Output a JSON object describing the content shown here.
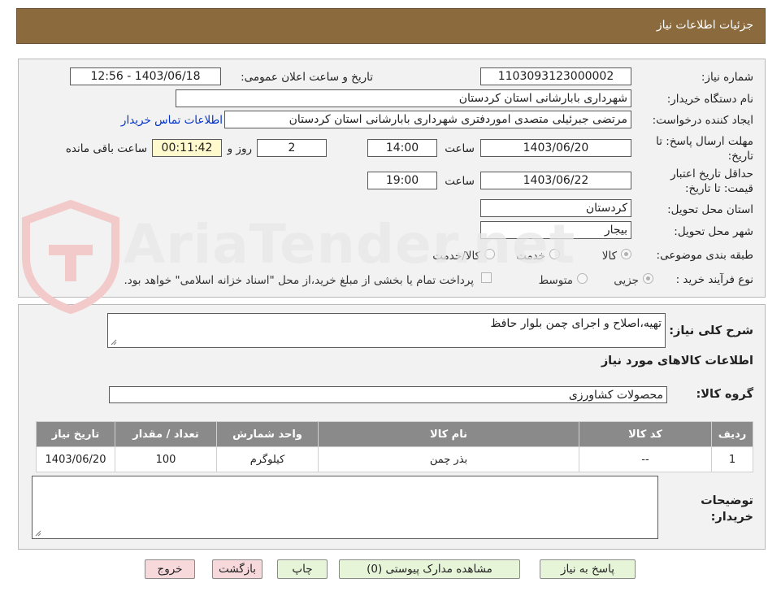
{
  "header": {
    "title": "جزئیات اطلاعات نیاز"
  },
  "need": {
    "number_label": "شماره نیاز:",
    "number": "1103093123000002",
    "announce_label": "تاریخ و ساعت اعلان عمومی:",
    "announce_value": "1403/06/18 - 12:56",
    "buyer_label": "نام دستگاه خریدار:",
    "buyer": "شهرداری بابارشانی استان کردستان",
    "creator_label": "ایجاد کننده درخواست:",
    "creator": "مرتضی جبرئیلی متصدی اموردفتری شهرداری بابارشانی استان کردستان",
    "contact_link": "اطلاعات تماس خریدار",
    "deadline_label": "مهلت ارسال پاسخ: تا تاریخ:",
    "deadline_date": "1403/06/20",
    "time_label": "ساعت",
    "deadline_time": "14:00",
    "days": "2",
    "days_label": "روز و",
    "remaining": "00:11:42",
    "remaining_label": "ساعت باقی مانده",
    "validity_label": "حداقل تاریخ اعتبار قیمت: تا تاریخ:",
    "validity_date": "1403/06/22",
    "validity_time": "19:00",
    "province_label": "استان محل تحویل:",
    "province": "کردستان",
    "city_label": "شهر محل تحویل:",
    "city": "بیجار",
    "category_label": "طبقه بندی موضوعی:",
    "category_options": [
      "کالا",
      "خدمت",
      "کالا/خدمت"
    ],
    "process_label": "نوع فرآیند خرید :",
    "process_options": [
      "جزیی",
      "متوسط"
    ],
    "treasury_note": "پرداخت تمام یا بخشی از مبلغ خرید،از محل \"اسناد خزانه اسلامی\" خواهد بود."
  },
  "details": {
    "desc_label": "شرح کلی نیاز:",
    "desc": "تهیه،اصلاح و اجرای چمن بلوار حافظ",
    "goods_title": "اطلاعات کالاهای مورد نیاز",
    "group_label": "گروه کالا:",
    "group": "محصولات کشاورزی",
    "table": {
      "headers": [
        "ردیف",
        "کد کالا",
        "نام کالا",
        "واحد شمارش",
        "تعداد / مقدار",
        "تاریخ نیاز"
      ],
      "rows": [
        [
          "1",
          "--",
          "بذر چمن",
          "کیلوگرم",
          "100",
          "1403/06/20"
        ]
      ]
    },
    "notes_label_1": "توضیحات",
    "notes_label_2": "خریدار:"
  },
  "buttons": {
    "reply": "پاسخ به نیاز",
    "attachments": "مشاهده مدارک پیوستی (0)",
    "print": "چاپ",
    "back": "بازگشت",
    "exit": "خروج"
  },
  "watermark": {
    "text": "AriaTender.net"
  },
  "colors": {
    "header": "#8b6a3e",
    "link": "#0033cc",
    "green_button": "#e6f5d8",
    "pink_button": "#f7d9dc",
    "table_header": "#8a8a8a"
  }
}
